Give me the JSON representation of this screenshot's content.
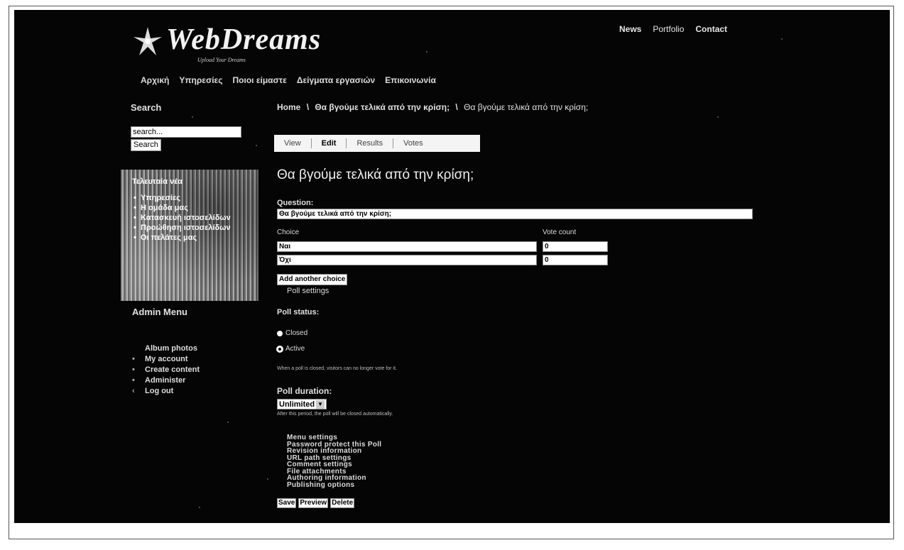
{
  "logo": {
    "text": "WebDreams",
    "tagline": "Upload Your Dreams"
  },
  "top_nav": [
    "News",
    "Portfolio",
    "Contact"
  ],
  "main_nav": [
    "Αρχική",
    "Υπηρεσίες",
    "Ποιοι είμαστε",
    "Δείγματα εργασιών",
    "Επικοινωνία"
  ],
  "sidebar": {
    "search_title": "Search",
    "search_placeholder": "search...",
    "search_button": "Search",
    "news_title": "Τελευταία νέα",
    "news_items": [
      "Υπηρεσίες",
      "Η ομάδα μας",
      "Κατασκευή ιστοσελίδων",
      "Προώθηση ιστοσελίδων",
      "Οι πελάτες μας"
    ],
    "admin_title": "Admin Menu",
    "admin_items": [
      "Album photos",
      "My account",
      "Create content",
      "Administer",
      "Log out"
    ]
  },
  "breadcrumb": [
    "Home",
    "Θα βγούμε τελικά από την κρίση;",
    "Θα βγούμε τελικά από την κρίση;"
  ],
  "breadcrumb_sep": "\\",
  "tabs": [
    "View",
    "Edit",
    "Results",
    "Votes"
  ],
  "page_title": "Θα βγούμε τελικά από την κρίση;",
  "form": {
    "question_label": "Question:",
    "question_value": "Θα βγούμε τελικά από την κρίση;",
    "choice_header": "Choice",
    "vote_header": "Vote count",
    "choices": [
      {
        "label": "Ναι",
        "votes": "0"
      },
      {
        "label": "Όχι",
        "votes": "0"
      }
    ],
    "add_choice": "Add another choice",
    "poll_settings": "Poll settings",
    "poll_status_label": "Poll status:",
    "status_options": [
      "Closed",
      "Active"
    ],
    "status_selected": "Active",
    "status_help": "When a poll is closed, visitors can no longer vote for it.",
    "duration_label": "Poll duration:",
    "duration_value": "Unlimited",
    "duration_help": "After this period, the poll will be closed automatically.",
    "settings_sections": [
      "Menu settings",
      "Password protect this Poll",
      "Revision information",
      "URL path settings",
      "Comment settings",
      "File attachments",
      "Authoring information",
      "Publishing options"
    ],
    "buttons": [
      "Save",
      "Preview",
      "Delete"
    ]
  }
}
